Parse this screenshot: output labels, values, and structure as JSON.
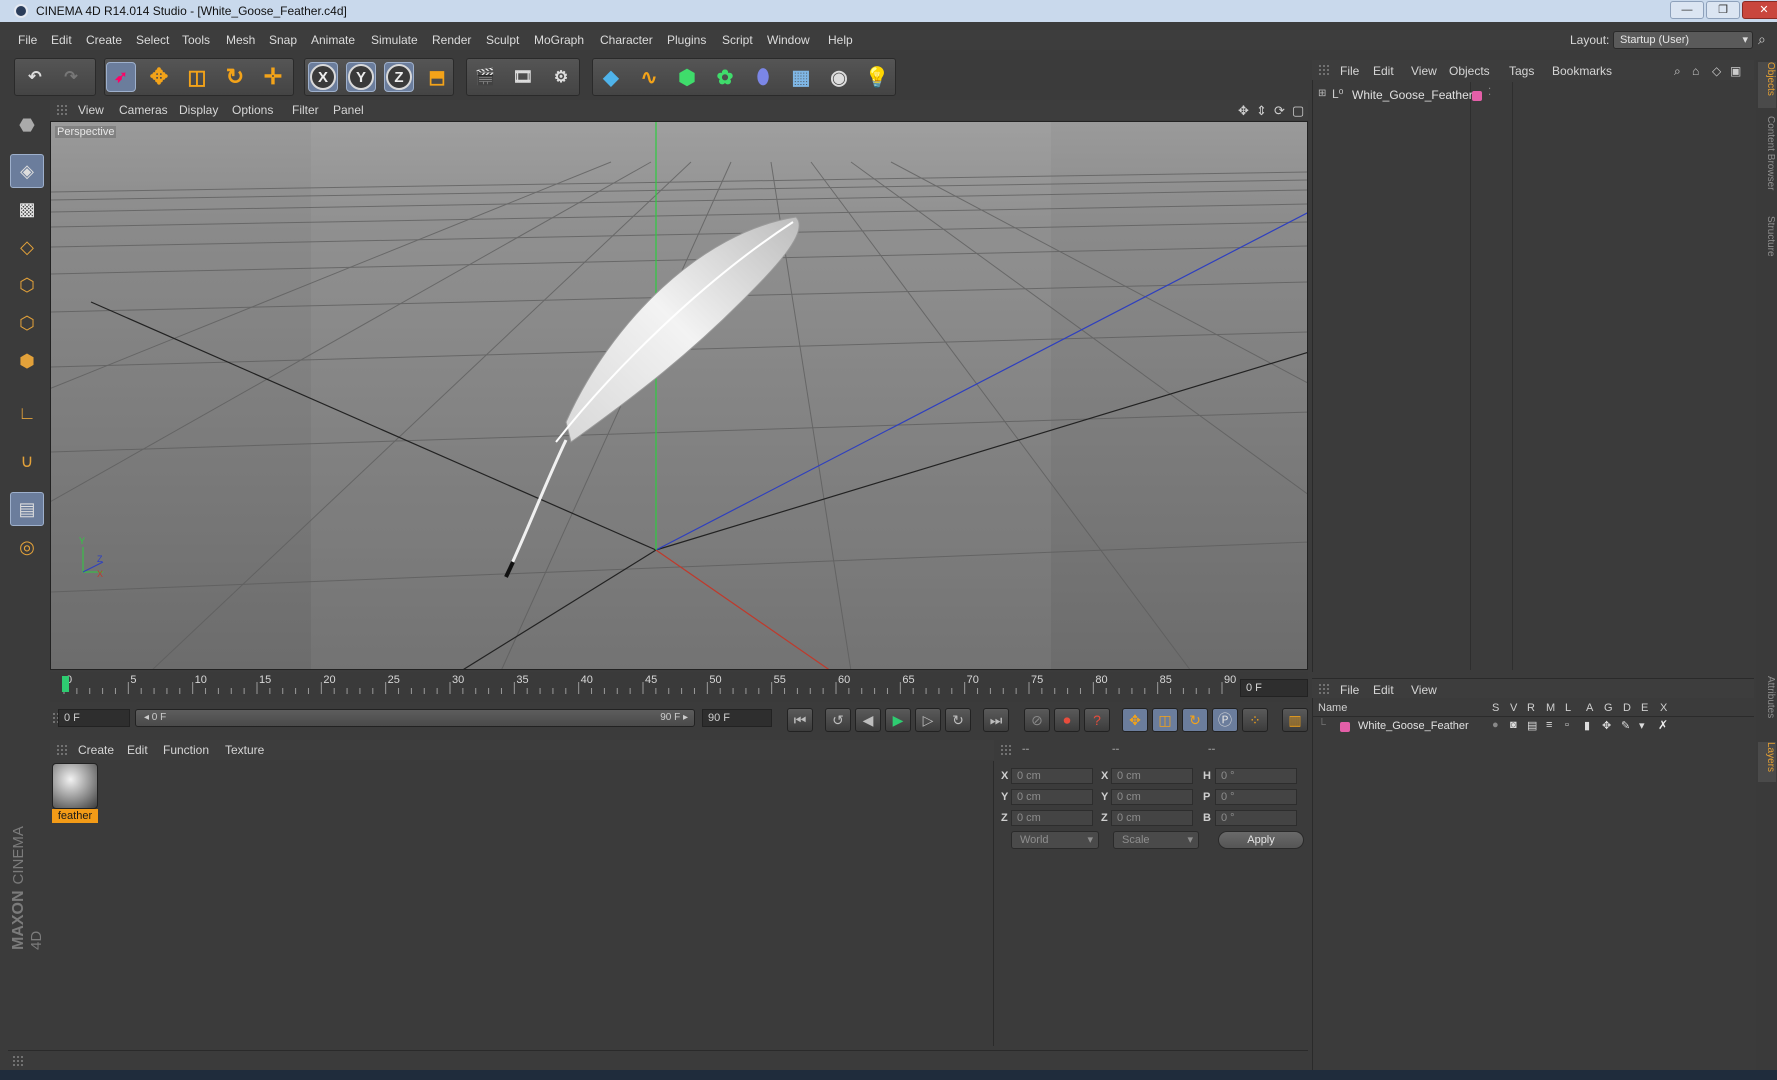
{
  "window": {
    "title": "CINEMA 4D R14.014 Studio - [White_Goose_Feather.c4d]"
  },
  "menubar": [
    "File",
    "Edit",
    "Create",
    "Select",
    "Tools",
    "Mesh",
    "Snap",
    "Animate",
    "Simulate",
    "Render",
    "Sculpt",
    "MoGraph",
    "Character",
    "Plugins",
    "Script",
    "Window",
    "Help"
  ],
  "layout": {
    "label": "Layout:",
    "value": "Startup (User)"
  },
  "viewport": {
    "menu": [
      "View",
      "Cameras",
      "Display",
      "Options",
      "Filter",
      "Panel"
    ],
    "label": "Perspective",
    "axis_y": "Y",
    "axis_z": "Z",
    "axis_x": "X"
  },
  "timeline": {
    "ticks": [
      "0",
      "5",
      "10",
      "15",
      "20",
      "25",
      "30",
      "35",
      "40",
      "45",
      "50",
      "55",
      "60",
      "65",
      "70",
      "75",
      "80",
      "85",
      "90"
    ],
    "current_frame": "0 F",
    "start_field": "0 F",
    "slider_start": "◂ 0 F",
    "slider_end": "90 F ▸",
    "end_field": "90 F"
  },
  "materials": {
    "menu": [
      "Create",
      "Edit",
      "Function",
      "Texture"
    ],
    "items": [
      {
        "name": "feather"
      }
    ]
  },
  "coordinates": {
    "headers": [
      "--",
      "--",
      "--"
    ],
    "rows": [
      {
        "a": "X",
        "av": "0 cm",
        "b": "X",
        "bv": "0 cm",
        "c": "H",
        "cv": "0 °"
      },
      {
        "a": "Y",
        "av": "0 cm",
        "b": "Y",
        "bv": "0 cm",
        "c": "P",
        "cv": "0 °"
      },
      {
        "a": "Z",
        "av": "0 cm",
        "b": "Z",
        "bv": "0 cm",
        "c": "B",
        "cv": "0 °"
      }
    ],
    "mode": "World",
    "size_mode": "Scale",
    "apply": "Apply"
  },
  "objects_panel": {
    "menu": [
      "File",
      "Edit",
      "View",
      "Objects",
      "Tags",
      "Bookmarks"
    ],
    "objects": [
      {
        "name": "White_Goose_Feather"
      }
    ]
  },
  "layers_panel": {
    "menu": [
      "File",
      "Edit",
      "View"
    ],
    "columns": [
      "Name",
      "S",
      "V",
      "R",
      "M",
      "L",
      "A",
      "G",
      "D",
      "E",
      "X"
    ],
    "rows": [
      {
        "name": "White_Goose_Feather"
      }
    ]
  },
  "side_tabs": [
    "Objects",
    "Content Browser",
    "Structure",
    "Attributes",
    "Layers"
  ],
  "branding": {
    "maxon": "MAXON",
    "product": "CINEMA 4D"
  },
  "colors": {
    "accent": "#f39b17",
    "selection": "#6b7d9c",
    "layer_tag": "#e45fa8",
    "axis_x": "#c0392b",
    "axis_y": "#2ecc40",
    "axis_z": "#2e3fbf"
  }
}
